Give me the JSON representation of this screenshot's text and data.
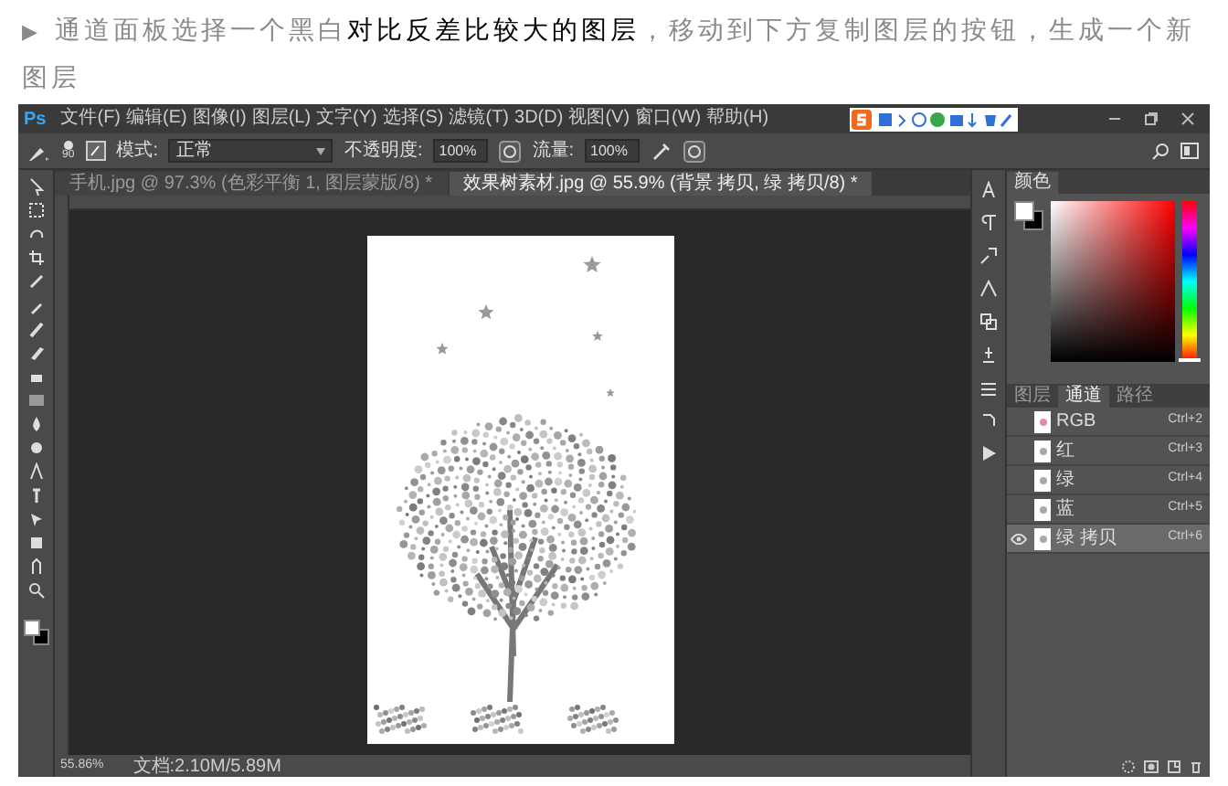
{
  "article": {
    "bullet": "▶",
    "text": "通道面板选择一个黑白**对比反差比较大的图层**，移动到下方复制图层的按钮，生成一个新图层"
  },
  "app": {
    "logo": "Ps",
    "menus": [
      "文件(F)",
      "编辑(E)",
      "图像(I)",
      "图层(L)",
      "文字(Y)",
      "选择(S)",
      "滤镜(T)",
      "3D(D)",
      "视图(V)",
      "窗口(W)",
      "帮助(H)"
    ]
  },
  "options": {
    "brush_size": "90",
    "mode_label": "模式:",
    "mode": "正常",
    "opacity_label": "不透明度:",
    "opacity": "100%",
    "flow_label": "流量:",
    "flow": "100%"
  },
  "tabs": [
    {
      "label": "手机.jpg @ 97.3% (色彩平衡 1, 图层蒙版/8) *",
      "selected": false
    },
    {
      "label": "效果树素材.jpg @ 55.9% (背景 拷贝, 绿 拷贝/8) *",
      "selected": true
    }
  ],
  "color_panel": {
    "tab": "颜色",
    "hue": {
      "level": 0
    }
  },
  "channels_panel": {
    "tabs": [
      {
        "label": "图层",
        "selected": false
      },
      {
        "label": "通道",
        "selected": true
      },
      {
        "label": "路径",
        "selected": false
      }
    ],
    "channels": [
      {
        "name": "RGB",
        "shortcut": "Ctrl+2",
        "visible": false,
        "selected": false
      },
      {
        "name": "红",
        "shortcut": "Ctrl+3",
        "visible": false,
        "selected": false
      },
      {
        "name": "绿",
        "shortcut": "Ctrl+4",
        "visible": false,
        "selected": false
      },
      {
        "name": "蓝",
        "shortcut": "Ctrl+5",
        "visible": false,
        "selected": false
      },
      {
        "name": "绿 拷贝",
        "shortcut": "Ctrl+6",
        "visible": true,
        "selected": true
      }
    ]
  },
  "status_bar": {
    "zoom": "55.86%",
    "doc": "文档:2.10M/5.89M"
  }
}
